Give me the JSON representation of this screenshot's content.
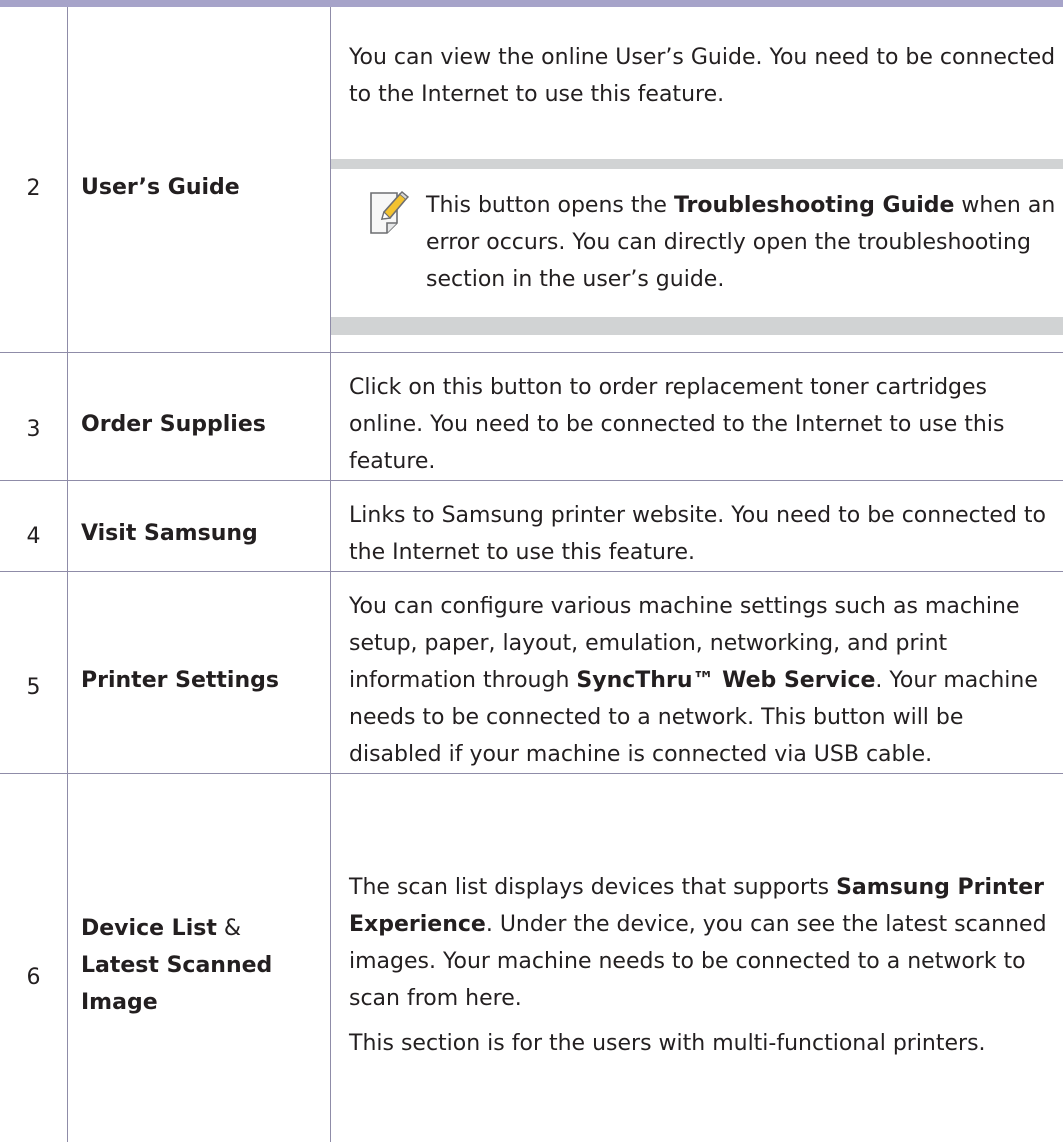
{
  "rows": [
    {
      "num": "2",
      "name": "User’s Guide",
      "desc": "You can view the online User’s Guide. You need to be connected to the Internet to use this feature.",
      "note": {
        "before": "This button opens the ",
        "bold": "Troubleshooting Guide",
        "after": " when an error occurs. You can directly open the troubleshooting section in the user’s guide."
      }
    },
    {
      "num": "3",
      "name": "Order Supplies",
      "desc": "Click on this button to order replacement toner cartridges online. You need to be connected to the Internet to use this feature."
    },
    {
      "num": "4",
      "name": "Visit Samsung",
      "desc": "Links to Samsung printer website. You need to be connected to the Internet to use this feature."
    },
    {
      "num": "5",
      "name": "Printer Settings",
      "desc_before": "You can configure various machine settings such as machine setup, paper, layout, emulation, networking, and print information through ",
      "desc_bold": "SyncThru™ Web Service",
      "desc_after": ". Your machine needs to be connected to a network. This button will be disabled if your machine is connected via USB cable."
    },
    {
      "num": "6",
      "name_part1": "Device List",
      "name_amp": " &",
      "name_part2": "Latest Scanned Image",
      "desc_before": "The scan list displays devices that supports ",
      "desc_bold": "Samsung Printer Experience",
      "desc_after": ". Under the device, you can see the latest scanned images. Your machine needs to be connected to a network to scan from here.",
      "desc_extra": "This section is for the users with multi-functional printers."
    }
  ],
  "icons": {
    "note": "note-pencil-icon"
  },
  "colors": {
    "topbar": "#a6a3c9",
    "rule": "#8f8ca8",
    "note_band": "#d1d3d4",
    "pencil": "#f3c230"
  }
}
